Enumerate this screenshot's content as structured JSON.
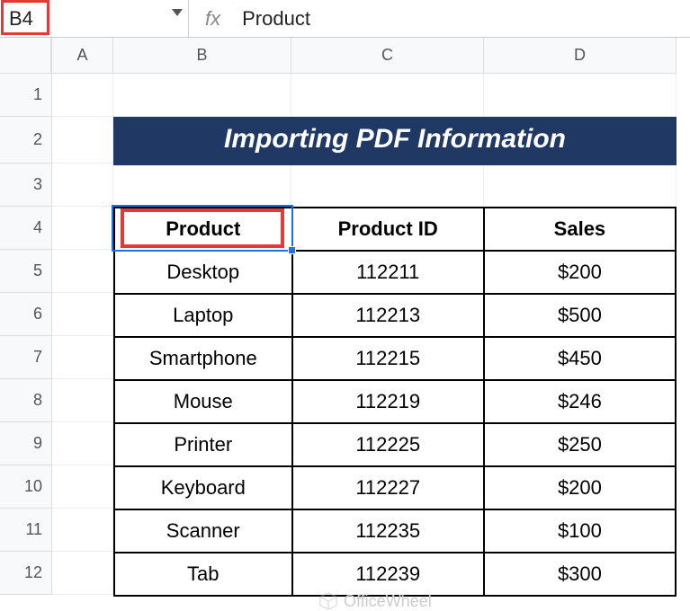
{
  "namebox": "B4",
  "formula": "Product",
  "fx_label": "fx",
  "columns": [
    "A",
    "B",
    "C",
    "D"
  ],
  "rows": [
    "1",
    "2",
    "3",
    "4",
    "5",
    "6",
    "7",
    "8",
    "9",
    "10",
    "11",
    "12"
  ],
  "title": "Importing PDF Information",
  "table": {
    "headers": [
      "Product",
      "Product ID",
      "Sales"
    ],
    "data": [
      [
        "Desktop",
        "112211",
        "$200"
      ],
      [
        "Laptop",
        "112213",
        "$500"
      ],
      [
        "Smartphone",
        "112215",
        "$450"
      ],
      [
        "Mouse",
        "112219",
        "$246"
      ],
      [
        "Printer",
        "112225",
        "$250"
      ],
      [
        "Keyboard",
        "112227",
        "$200"
      ],
      [
        "Scanner",
        "112235",
        "$100"
      ],
      [
        "Tab",
        "112239",
        "$300"
      ]
    ]
  },
  "watermark": "OfficeWheel",
  "chart_data": {
    "type": "table",
    "title": "Importing PDF Information",
    "columns": [
      "Product",
      "Product ID",
      "Sales"
    ],
    "rows": [
      {
        "Product": "Desktop",
        "Product ID": 112211,
        "Sales": 200
      },
      {
        "Product": "Laptop",
        "Product ID": 112213,
        "Sales": 500
      },
      {
        "Product": "Smartphone",
        "Product ID": 112215,
        "Sales": 450
      },
      {
        "Product": "Mouse",
        "Product ID": 112219,
        "Sales": 246
      },
      {
        "Product": "Printer",
        "Product ID": 112225,
        "Sales": 250
      },
      {
        "Product": "Keyboard",
        "Product ID": 112227,
        "Sales": 200
      },
      {
        "Product": "Scanner",
        "Product ID": 112235,
        "Sales": 100
      },
      {
        "Product": "Tab",
        "Product ID": 112239,
        "Sales": 300
      }
    ]
  }
}
